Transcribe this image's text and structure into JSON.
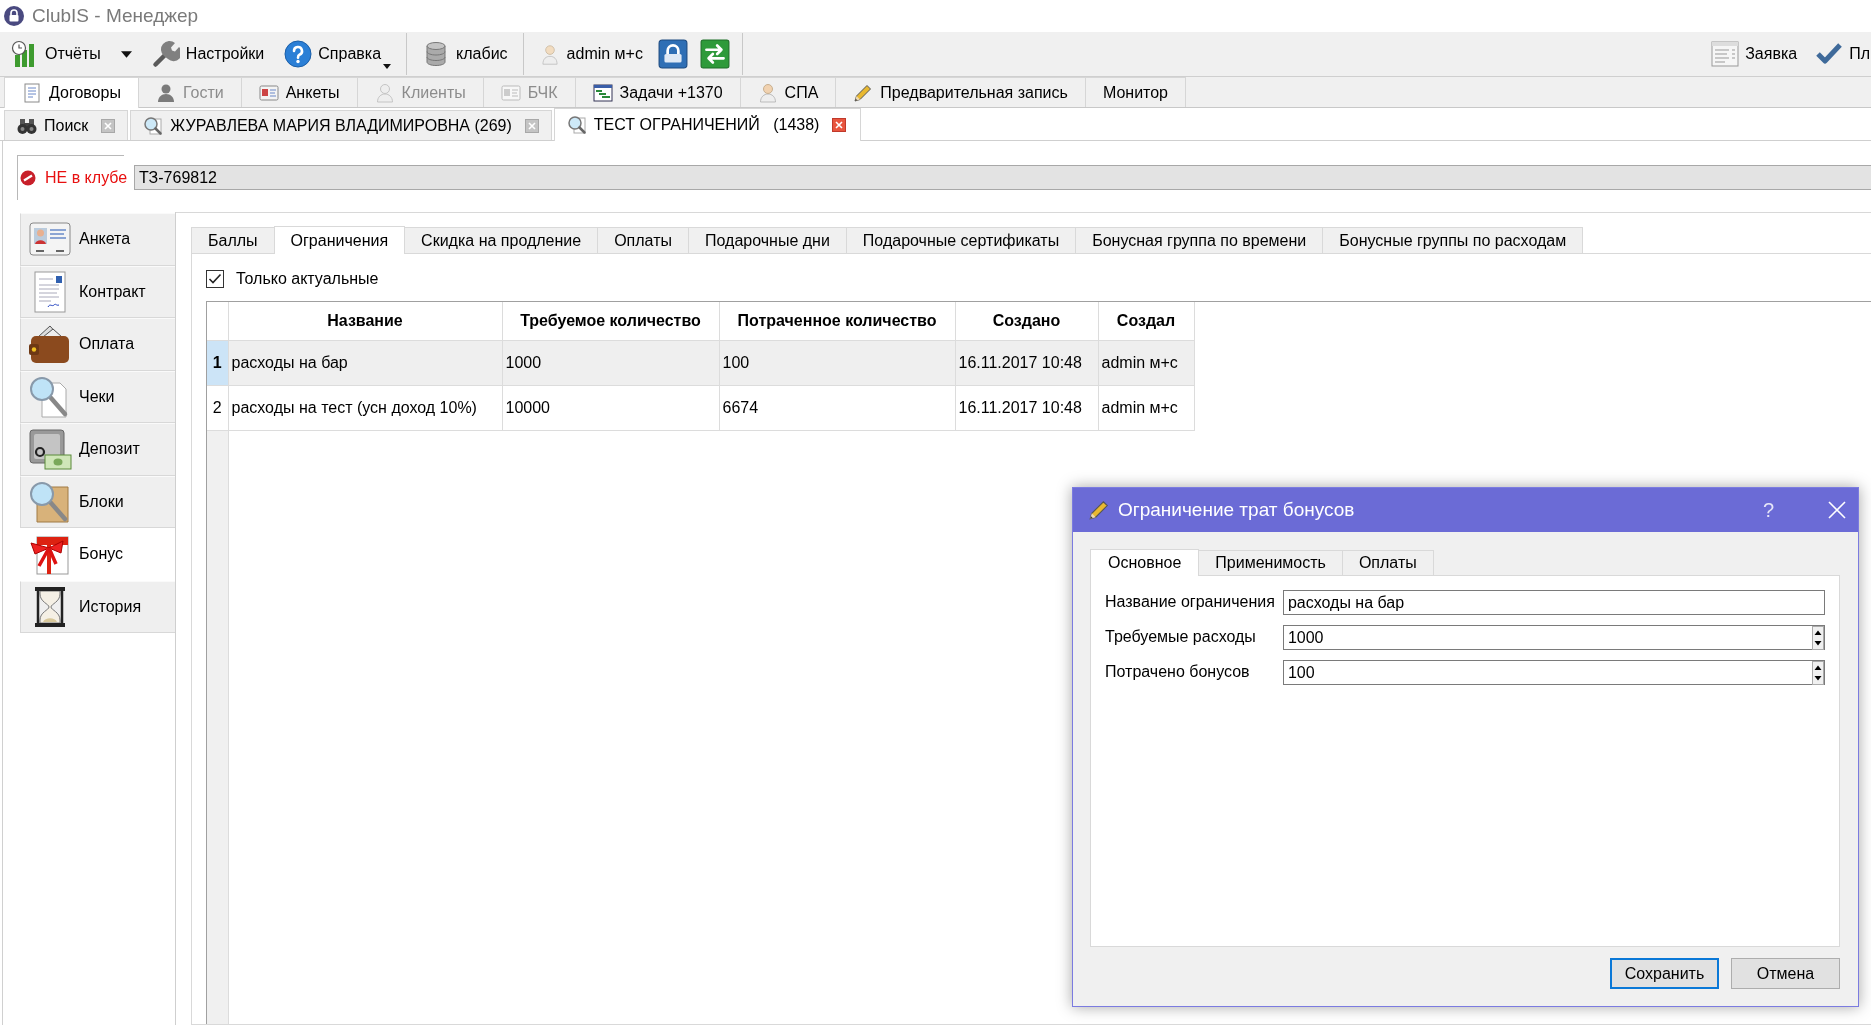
{
  "window": {
    "title": "ClubIS - Менеджер"
  },
  "toolbar": {
    "items": [
      {
        "label": "Отчёты",
        "kind": "split"
      },
      {
        "label": "Настройки",
        "kind": "button"
      },
      {
        "label": "Справка",
        "kind": "menu"
      },
      {
        "kind": "separator"
      },
      {
        "label": "клабис",
        "kind": "button"
      },
      {
        "kind": "separator"
      },
      {
        "label": "admin м+с",
        "kind": "button"
      },
      {
        "kind": "icon"
      },
      {
        "kind": "icon"
      },
      {
        "kind": "separator"
      }
    ],
    "right": [
      {
        "label": "Заявка"
      },
      {
        "label": "Пл"
      }
    ]
  },
  "main_tabs": [
    {
      "label": "Договоры",
      "selected": true,
      "disabled": false
    },
    {
      "label": "Гости",
      "selected": false,
      "disabled": true
    },
    {
      "label": "Анкеты",
      "selected": false,
      "disabled": false
    },
    {
      "label": "Клиенты",
      "selected": false,
      "disabled": true
    },
    {
      "label": "БЧК",
      "selected": false,
      "disabled": true
    },
    {
      "label": "Задачи +1370",
      "selected": false,
      "disabled": false
    },
    {
      "label": "СПА",
      "selected": false,
      "disabled": false
    },
    {
      "label": "Предварительная запись",
      "selected": false,
      "disabled": false
    },
    {
      "label": "Монитор",
      "selected": false,
      "disabled": false
    }
  ],
  "doc_tabs": [
    {
      "label": "Поиск",
      "selected": false
    },
    {
      "label": "ЖУРАВЛЕВА МАРИЯ ВЛАДИМИРОВНА (269)",
      "selected": false
    },
    {
      "label": "ТЕСТ ОГРАНИЧЕНИЙ   (1438)",
      "selected": true
    }
  ],
  "client": {
    "status": "НЕ в клубе",
    "card": "ТЗ-769812"
  },
  "sidebar": {
    "items": [
      {
        "label": "Анкета",
        "selected": false
      },
      {
        "label": "Контракт",
        "selected": false
      },
      {
        "label": "Оплата",
        "selected": false
      },
      {
        "label": "Чеки",
        "selected": false
      },
      {
        "label": "Депозит",
        "selected": false
      },
      {
        "label": "Блоки",
        "selected": false
      },
      {
        "label": "Бонус",
        "selected": true
      },
      {
        "label": "История",
        "selected": false
      }
    ]
  },
  "sub_tabs": [
    {
      "label": "Баллы",
      "selected": false
    },
    {
      "label": "Ограничения",
      "selected": true
    },
    {
      "label": "Скидка на продление",
      "selected": false
    },
    {
      "label": "Оплаты",
      "selected": false
    },
    {
      "label": "Подарочные дни",
      "selected": false
    },
    {
      "label": "Подарочные сертификаты",
      "selected": false
    },
    {
      "label": "Бонусная группа по времени",
      "selected": false
    },
    {
      "label": "Бонусные группы по расходам",
      "selected": false
    }
  ],
  "filter": {
    "label": "Только актуальные",
    "checked": true
  },
  "table": {
    "columns": [
      "Название",
      "Требуемое количество",
      "Потраченное количество",
      "Создано",
      "Создал"
    ],
    "rows": [
      {
        "number": "1",
        "selected": true,
        "cells": [
          "расходы на бар",
          "1000",
          "100",
          "16.11.2017 10:48",
          "admin м+с"
        ]
      },
      {
        "number": "2",
        "selected": false,
        "cells": [
          "расходы на тест (усн доход 10%)",
          "10000",
          "6674",
          "16.11.2017 10:48",
          "admin м+с"
        ]
      }
    ]
  },
  "dialog": {
    "title": "Ограничение трат бонусов",
    "help": "?",
    "tabs": [
      {
        "label": "Основное",
        "selected": true
      },
      {
        "label": "Применимость",
        "selected": false
      },
      {
        "label": "Оплаты",
        "selected": false
      }
    ],
    "fields": [
      {
        "label": "Название ограничения",
        "value": "расходы на бар",
        "kind": "text"
      },
      {
        "label": "Требуемые расходы",
        "value": "1000",
        "kind": "spin"
      },
      {
        "label": "Потрачено бонусов",
        "value": "100",
        "kind": "spin"
      }
    ],
    "buttons": [
      {
        "label": "Сохранить",
        "default": true
      },
      {
        "label": "Отмена",
        "default": false
      }
    ]
  }
}
